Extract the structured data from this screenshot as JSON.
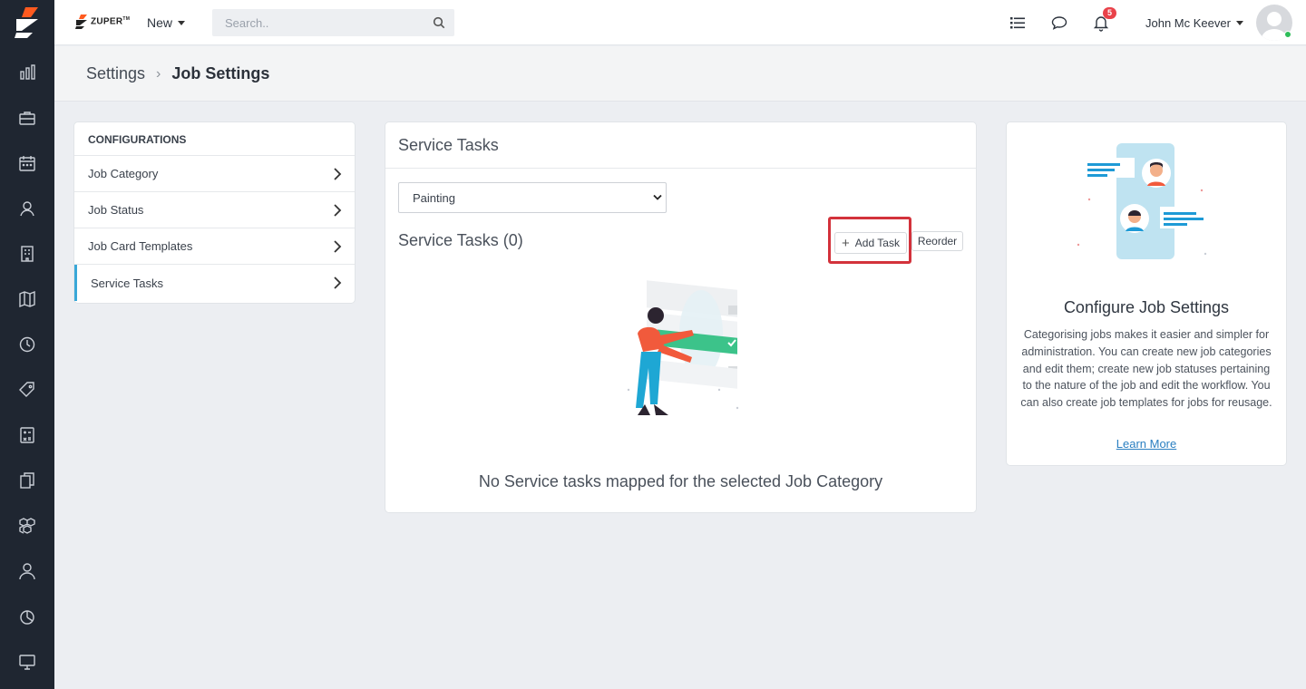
{
  "app": {
    "brand": "ZUPER",
    "brand_mark": "TM"
  },
  "topbar": {
    "new_label": "New",
    "search_placeholder": "Search..",
    "notification_count": "5",
    "user_name": "John Mc Keever"
  },
  "breadcrumb": {
    "parent": "Settings",
    "separator": "›",
    "current": "Job Settings"
  },
  "sidebar_icons": [
    "reports-icon",
    "briefcase-icon",
    "calendar-icon",
    "customers-icon",
    "building-icon",
    "map-icon",
    "clock-icon",
    "tag-icon",
    "calculator-icon",
    "documents-icon",
    "boxes-icon",
    "user-icon",
    "chart-pie-icon",
    "monitor-icon"
  ],
  "config": {
    "heading": "CONFIGURATIONS",
    "items": [
      {
        "label": "Job Category"
      },
      {
        "label": "Job Status"
      },
      {
        "label": "Job Card Templates"
      },
      {
        "label": "Service Tasks",
        "active": true
      }
    ]
  },
  "tasks": {
    "title": "Service Tasks",
    "category_selected": "Painting",
    "list_title": "Service Tasks (0)",
    "add_label": "Add Task",
    "reorder_label": "Reorder",
    "empty_message": "No Service tasks mapped for the selected Job Category"
  },
  "info": {
    "title": "Configure Job Settings",
    "body": "Categorising jobs makes it easier and simpler for administration. You can create new job categories and edit them; create new job statuses pertaining to the nature of the job and edit the workflow. You can also create job templates for jobs for reusage.",
    "link": "Learn More"
  },
  "colors": {
    "rail": "#1f2631",
    "accent": "#3aa8d8",
    "highlight": "#d3323b",
    "badge": "#e9424a",
    "link": "#2a7fc1"
  }
}
